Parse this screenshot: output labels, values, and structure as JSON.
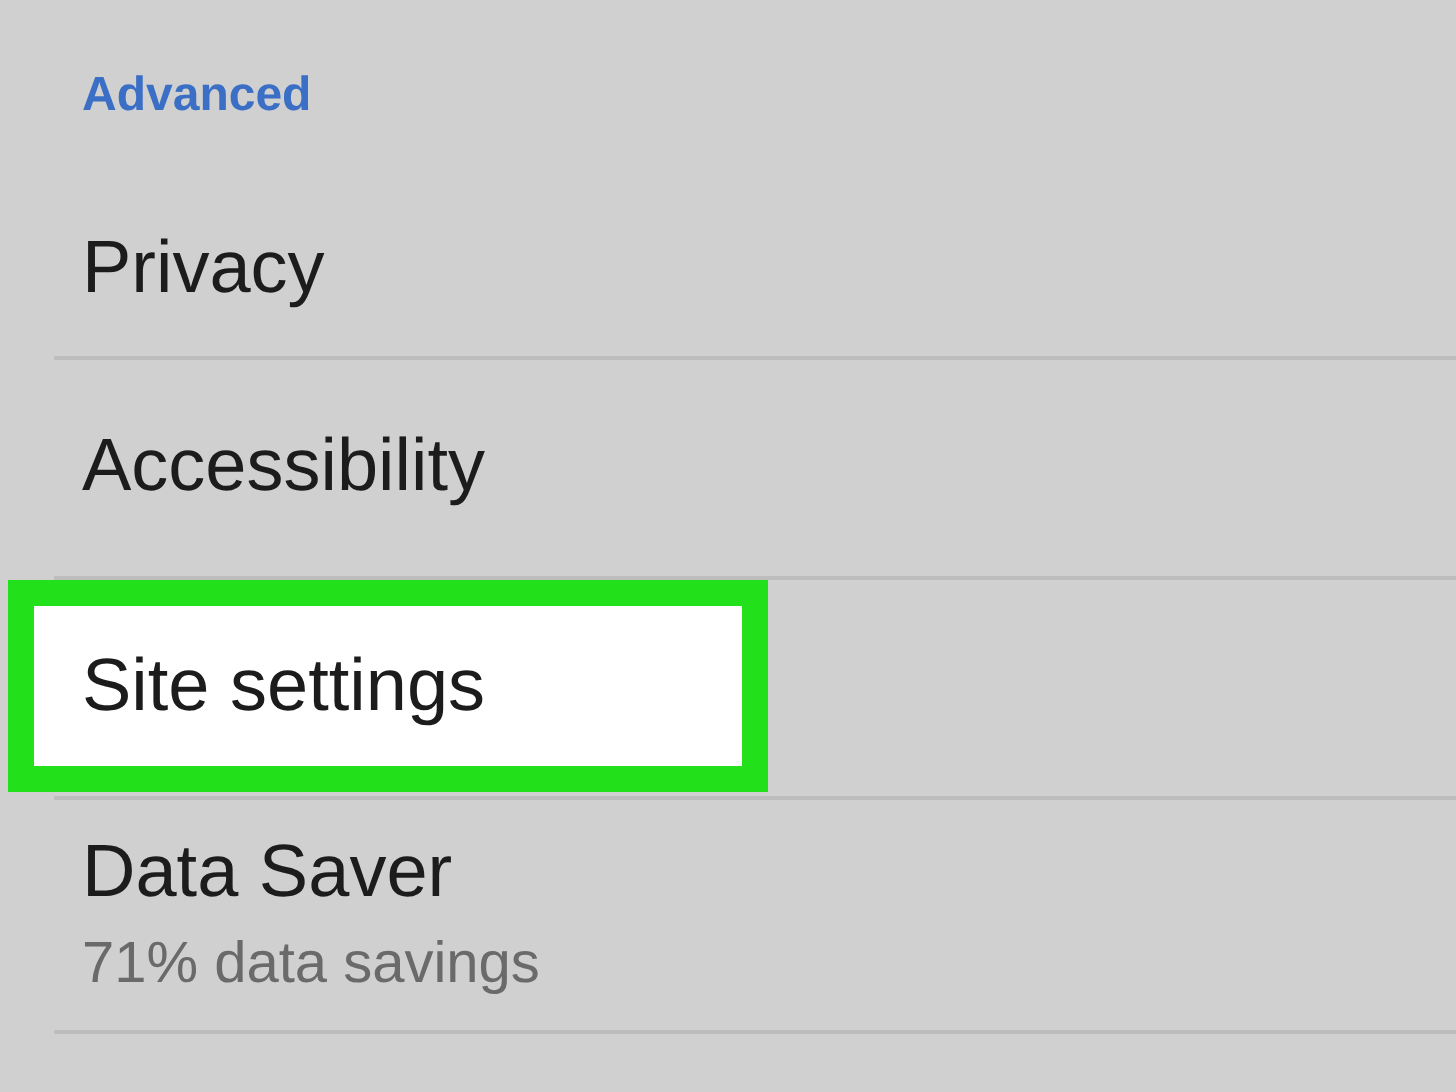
{
  "section_header": "Advanced",
  "items": [
    {
      "title": "Privacy",
      "highlighted": false
    },
    {
      "title": "Accessibility",
      "highlighted": false
    },
    {
      "title": "Site settings",
      "highlighted": true
    },
    {
      "title": "Data Saver",
      "subtitle": "71% data savings",
      "highlighted": false
    }
  ]
}
